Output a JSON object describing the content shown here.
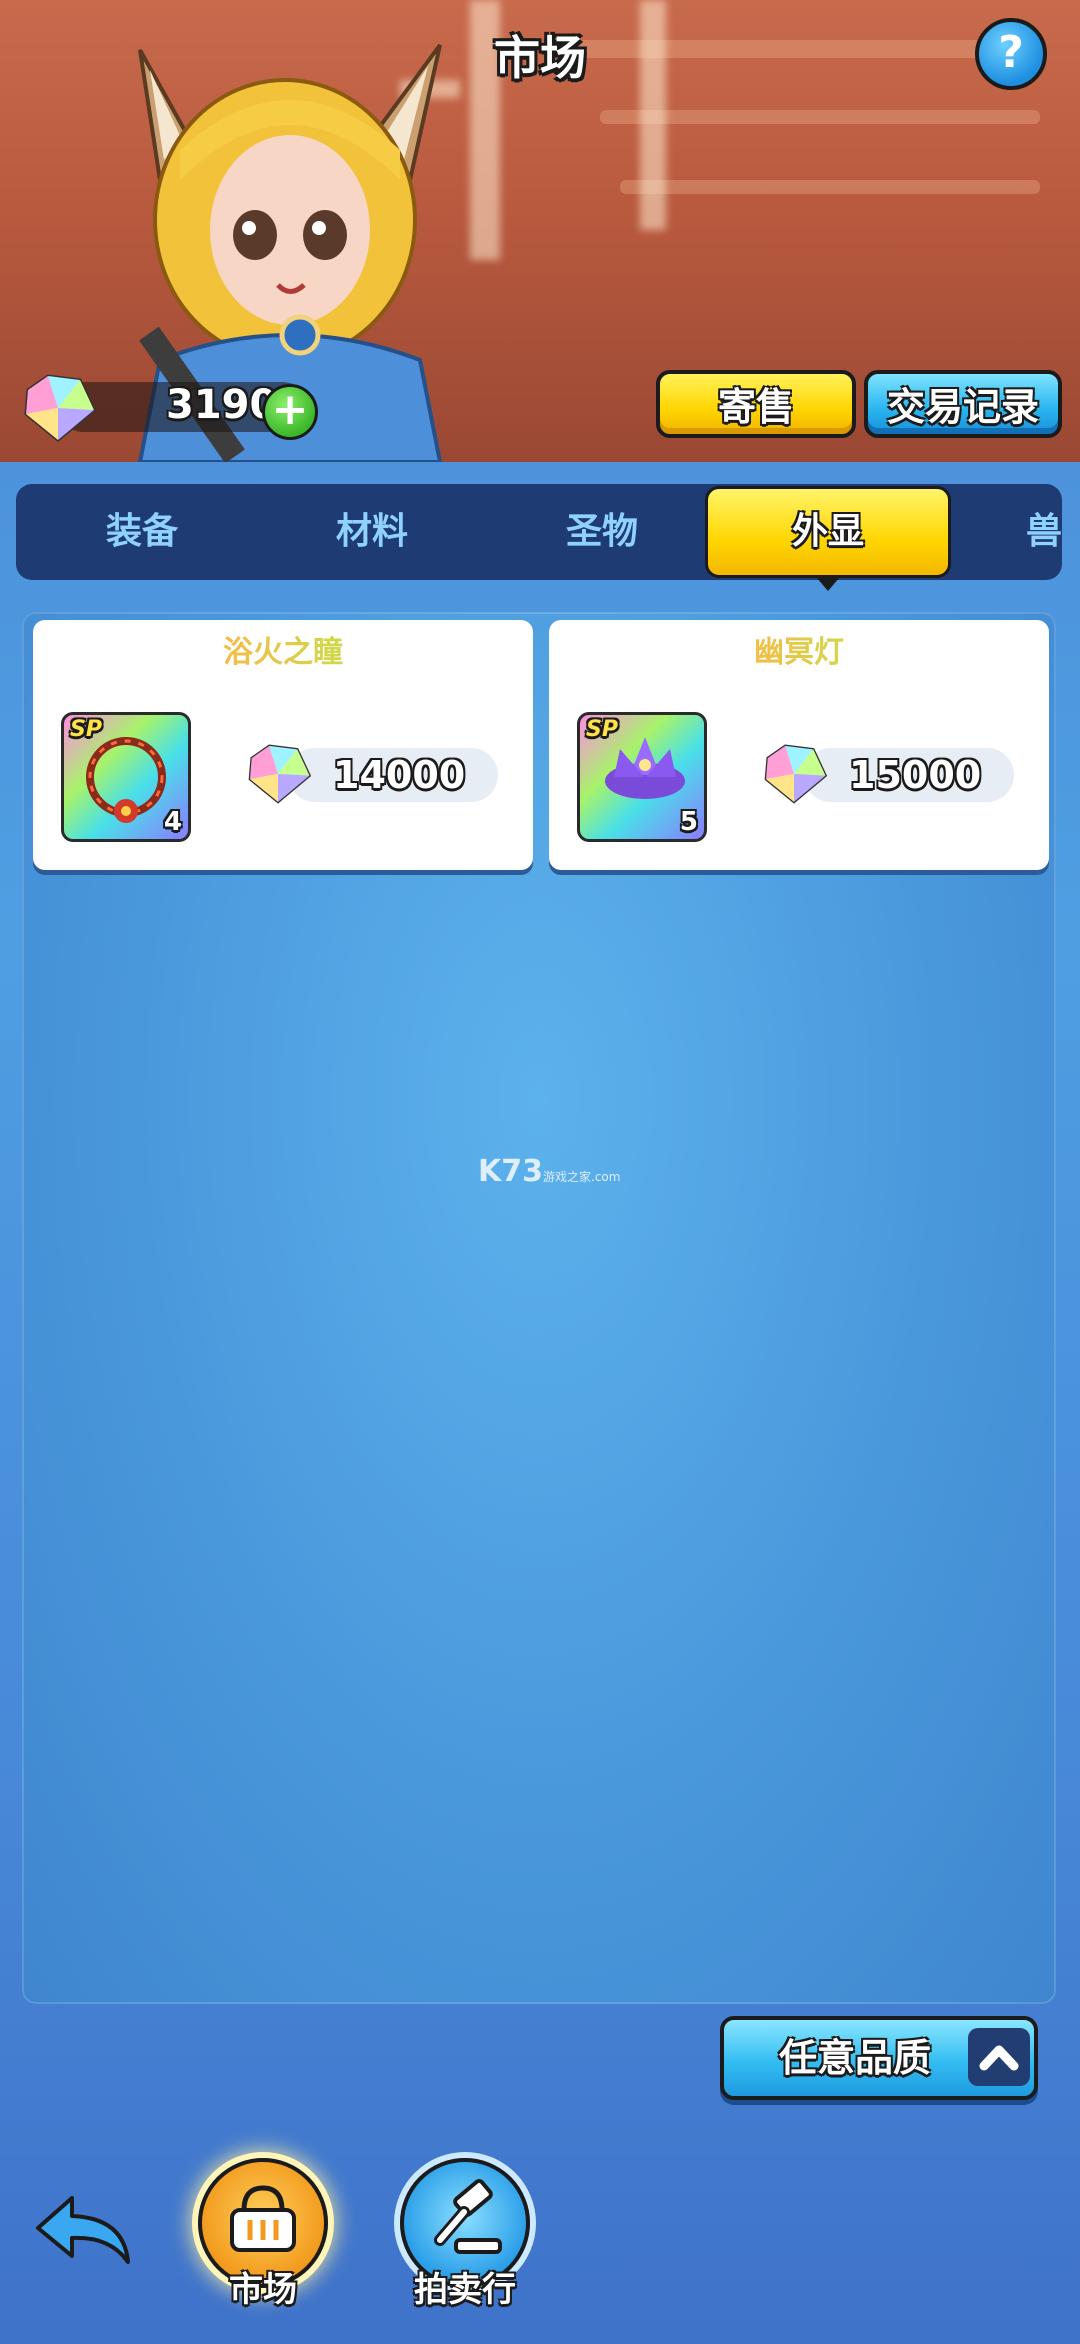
{
  "header": {
    "title": "市场",
    "help_label": "?",
    "currency": {
      "icon": "diamond-gem-icon",
      "value": "3190",
      "add_label": "+"
    },
    "sell_button": "寄售",
    "records_button": "交易记录"
  },
  "tabs": [
    {
      "label": "装备",
      "active": false
    },
    {
      "label": "材料",
      "active": false
    },
    {
      "label": "圣物",
      "active": false
    },
    {
      "label": "外显",
      "active": true
    },
    {
      "label": "兽",
      "active": false
    }
  ],
  "listings": [
    {
      "name": "浴火之瞳",
      "badge": "SP",
      "level": "4",
      "price": "14000",
      "price_icon": "diamond-gem-icon"
    },
    {
      "name": "幽冥灯",
      "badge": "SP",
      "level": "5",
      "price": "15000",
      "price_icon": "diamond-gem-icon"
    }
  ],
  "watermark": {
    "main": "K73",
    "sub1": "游戏之家",
    "sub2": ".com"
  },
  "filter": {
    "quality_label": "任意品质",
    "icon": "chevron-up-icon"
  },
  "bottom_nav": {
    "back_icon": "back-arrow-icon",
    "items": [
      {
        "label": "市场",
        "icon": "basket-icon",
        "active": true
      },
      {
        "label": "拍卖行",
        "icon": "gavel-icon",
        "active": false
      }
    ]
  },
  "colors": {
    "accent_yellow": "#FFD400",
    "accent_blue": "#28B4F0",
    "tab_bar": "#1F3B73",
    "background": "#4A98DC"
  }
}
